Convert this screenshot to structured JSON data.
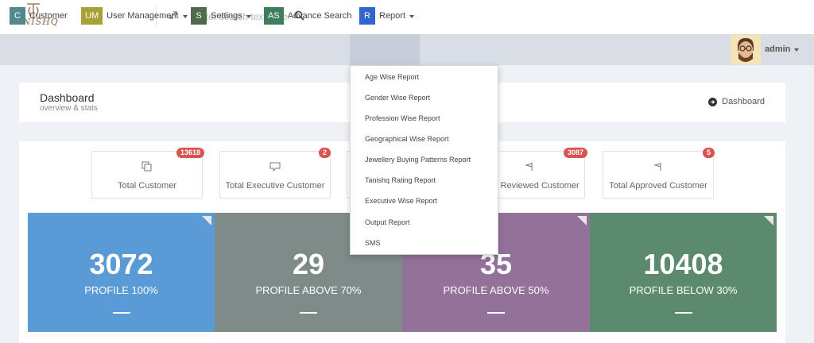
{
  "header": {
    "logo_text": "TANISHQ",
    "search_placeholder": "Enter search text here..."
  },
  "nav": {
    "items": [
      {
        "badge": "C",
        "label": "Customer",
        "color": "#4e8a8f"
      },
      {
        "badge": "UM",
        "label": "User Management",
        "color": "#a8a236"
      },
      {
        "badge": "S",
        "label": "Settings",
        "color": "#506b4c"
      },
      {
        "badge": "AS",
        "label": "Advance Search",
        "color": "#3e7e5e"
      },
      {
        "badge": "R",
        "label": "Report",
        "color": "#3366cc"
      }
    ],
    "user": "admin"
  },
  "page": {
    "title": "Dashboard",
    "subtitle": "overview & stats",
    "breadcrumb": "Dashboard"
  },
  "stat_cards": [
    {
      "label": "Total Customer",
      "badge": "13618"
    },
    {
      "label": "Total Executive Customer",
      "badge": "2"
    },
    {
      "label": "Total ... Customer",
      "badge": ""
    },
    {
      "label": "Total Reviewed Customer",
      "badge": "3087"
    },
    {
      "label": "Total Approved Customer",
      "badge": "5"
    }
  ],
  "tiles": [
    {
      "value": "3072",
      "label": "PROFILE 100%",
      "color": "#5b9bd5"
    },
    {
      "value": "29",
      "label": "PROFILE ABOVE 70%",
      "color": "#7e8b88"
    },
    {
      "value": "35",
      "label": "PROFILE ABOVE 50%",
      "color": "#93729a"
    },
    {
      "value": "10408",
      "label": "PROFILE BELOW 30%",
      "color": "#5b8a6e"
    }
  ],
  "report_menu": [
    "Age Wise Report",
    "Gender Wise Report",
    "Profession Wise Report",
    "Geographical Wise Report",
    "Jewellery Buying Patterns Report",
    "Tanishq Rating Report",
    "Executive Wise Report",
    "Output Report",
    "SMS"
  ]
}
